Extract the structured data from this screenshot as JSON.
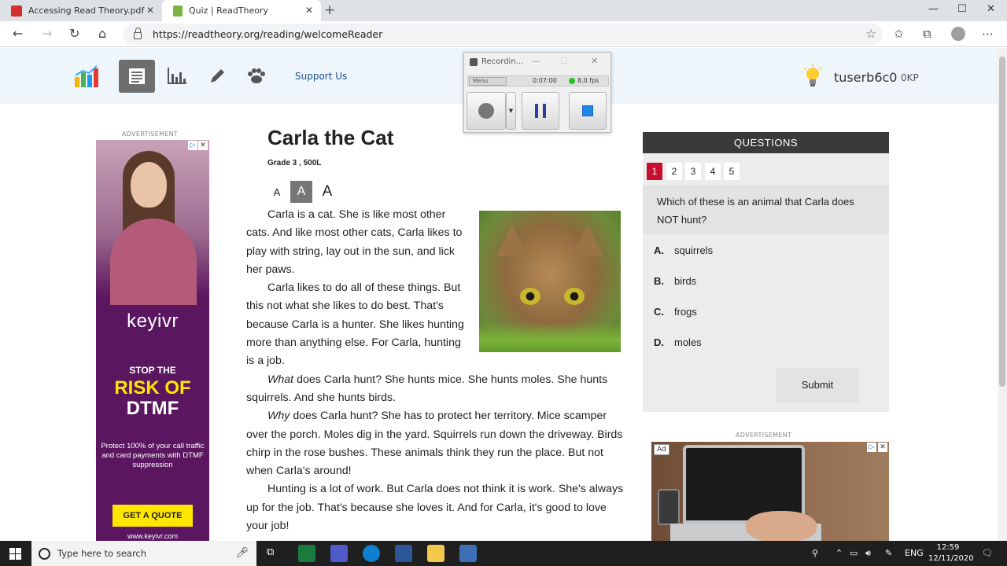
{
  "browser": {
    "tabs": [
      {
        "title": "Accessing Read Theory.pdf",
        "active": false
      },
      {
        "title": "Quiz | ReadTheory",
        "active": true
      }
    ],
    "url": "https://readtheory.org/reading/welcomeReader"
  },
  "header": {
    "support_label": "Support Us",
    "username": "tuserb6c0",
    "points": "0KP"
  },
  "recorder": {
    "title": "Recordin...",
    "menu": "Menu",
    "time": "0:07:00",
    "fps": "8.0 fps"
  },
  "left_ad": {
    "label": "ADVERTISEMENT",
    "brand": "keyivr",
    "line1": "STOP THE",
    "line2": "RISK OF",
    "line3": "DTMF",
    "body": "Protect 100% of your call traffic and card payments with DTMF suppression",
    "cta": "GET A QUOTE",
    "url": "www.keyivr.com"
  },
  "story": {
    "title": "Carla the Cat",
    "grade": "Grade 3 , 500L",
    "font_sizes": [
      "A",
      "A",
      "A"
    ],
    "paragraphs": [
      {
        "lead": "",
        "text": "Carla is a cat. She is like most other cats. And like most other cats, Carla likes to play with string, lay out in the sun, and lick her paws."
      },
      {
        "lead": "",
        "text": "Carla likes to do all of these things. But this not what she likes to do best. That's because Carla is a hunter. She likes hunting more than anything else. For Carla, hunting is a job."
      },
      {
        "lead": "What",
        "text": " does Carla hunt? She hunts mice. She hunts moles. She hunts squirrels. And she hunts birds."
      },
      {
        "lead": "Why",
        "text": " does Carla hunt? She has to protect her territory. Mice scamper over the porch. Moles dig in the yard. Squirrels run down the driveway. Birds chirp in the rose bushes. These animals think they run the place. But not when Carla's around!"
      },
      {
        "lead": "",
        "text": "Hunting is a lot of work. But Carla does not think it is work. She's always up for the job. That's because she loves it. And for Carla, it's good to love your job!"
      }
    ]
  },
  "questions": {
    "heading": "QUESTIONS",
    "numbers": [
      "1",
      "2",
      "3",
      "4",
      "5"
    ],
    "active": "1",
    "prompt": "Which of these is an animal that Carla does NOT hunt?",
    "options": [
      {
        "letter": "A.",
        "text": "squirrels"
      },
      {
        "letter": "B.",
        "text": "birds"
      },
      {
        "letter": "C.",
        "text": "frogs"
      },
      {
        "letter": "D.",
        "text": "moles"
      }
    ],
    "submit_label": "Submit"
  },
  "right_ad": {
    "label": "ADVERTISEMENT",
    "badge": "Ad"
  },
  "taskbar": {
    "search_placeholder": "Type here to search",
    "language": "ENG",
    "time": "12:59",
    "date": "12/11/2020"
  },
  "colors": {
    "header_bg": "#eef6fc",
    "question_active": "#c8102e",
    "ad_purple": "#5b1660",
    "ad_yellow": "#ffe600"
  }
}
